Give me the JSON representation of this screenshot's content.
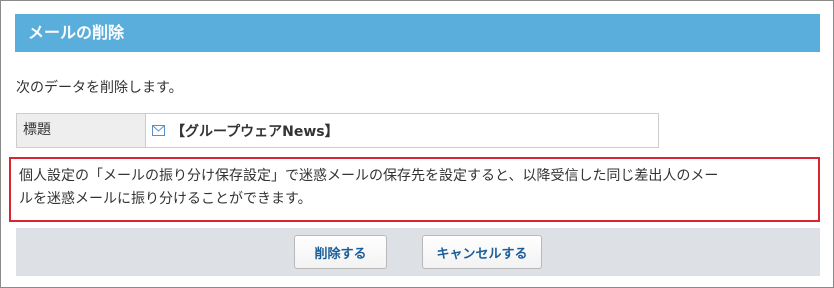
{
  "header": {
    "title": "メールの削除"
  },
  "message": "次のデータを削除します。",
  "info": {
    "label": "標題",
    "value": "【グループウェアNews】",
    "icon": "mail-icon"
  },
  "notice": {
    "line1": "個人設定の「メールの振り分け保存設定」で迷惑メールの保存先を設定すると、以降受信した同じ差出人のメー",
    "line2": "ルを迷惑メールに振り分けることができます。"
  },
  "buttons": {
    "delete_label": "削除する",
    "cancel_label": "キャンセルする"
  },
  "colors": {
    "title_bar": "#5aaedc",
    "notice_border": "#d9252f",
    "button_text": "#1b5d9a"
  }
}
